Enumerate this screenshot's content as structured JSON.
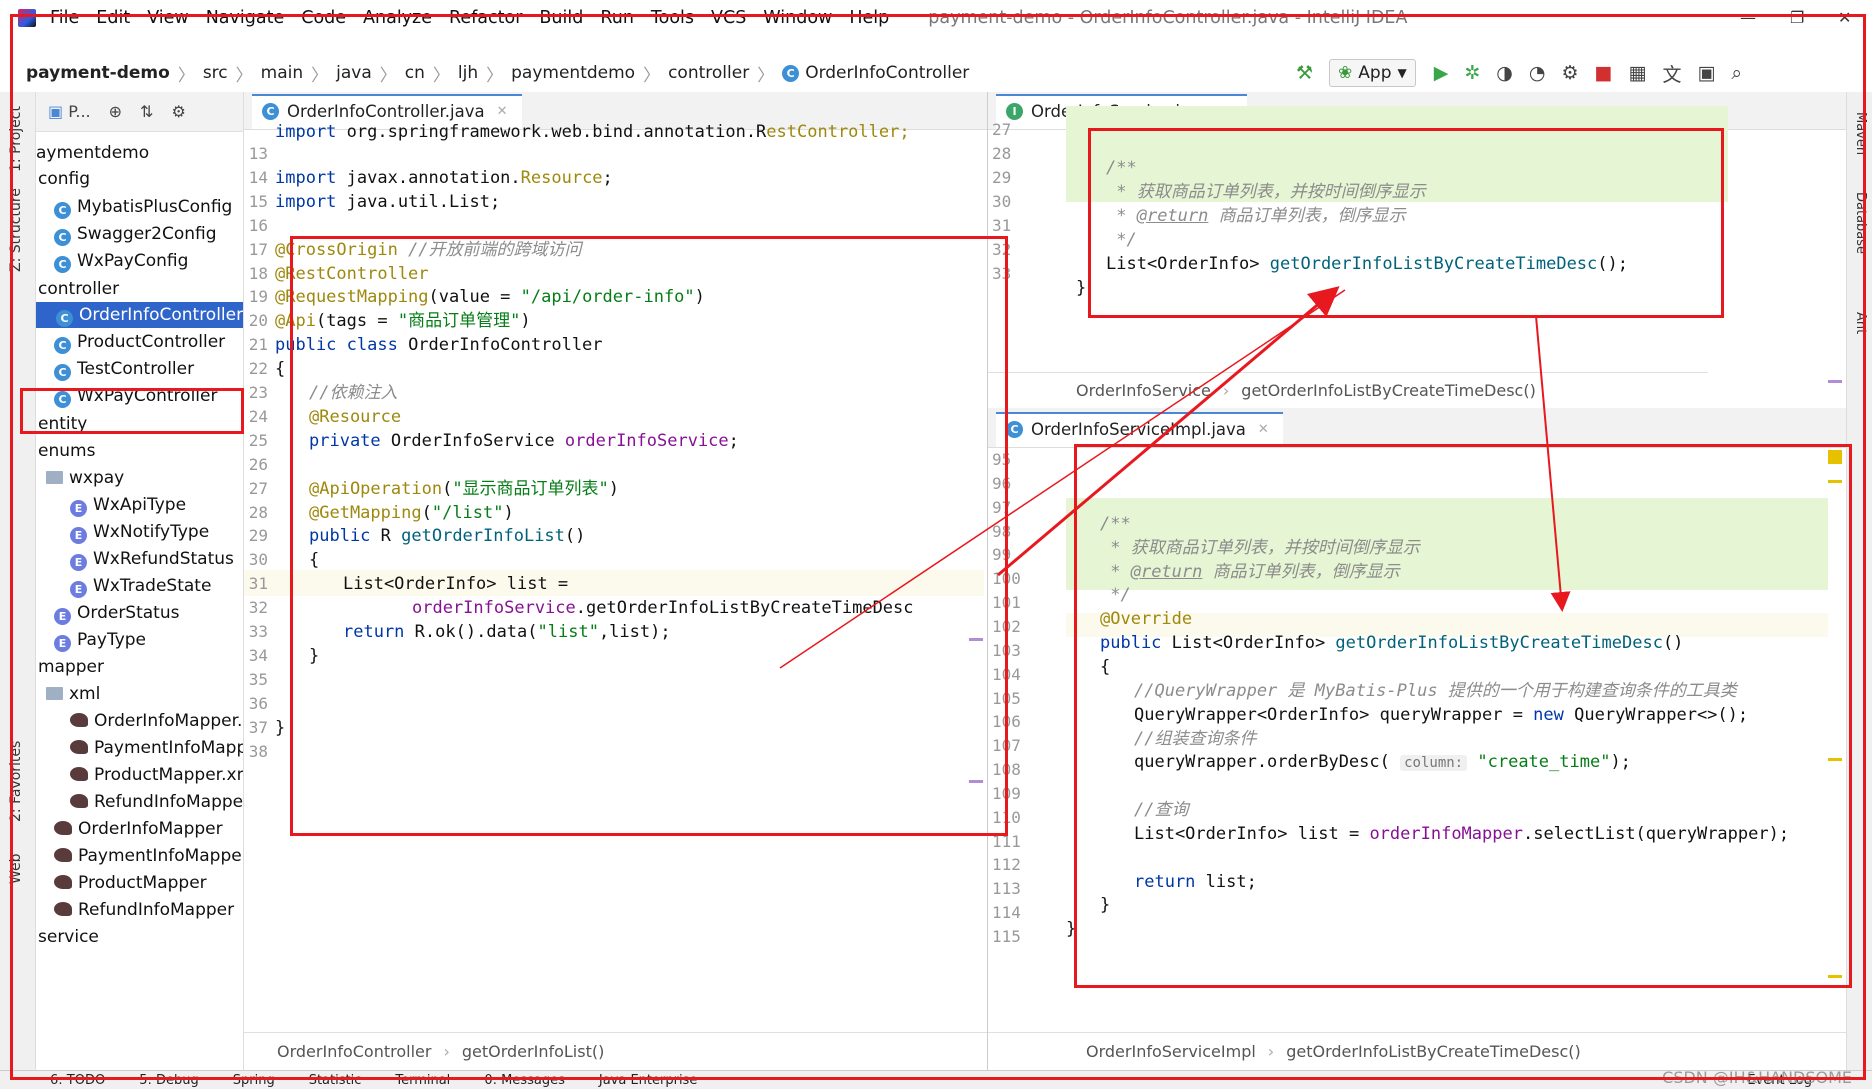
{
  "menu": {
    "items": [
      "File",
      "Edit",
      "View",
      "Navigate",
      "Code",
      "Analyze",
      "Refactor",
      "Build",
      "Run",
      "Tools",
      "VCS",
      "Window",
      "Help"
    ],
    "window_title": "payment-demo - OrderInfoController.java - IntelliJ IDEA"
  },
  "breadcrumb": {
    "project": "payment-demo",
    "parts": [
      "src",
      "main",
      "java",
      "cn",
      "ljh",
      "paymentdemo",
      "controller"
    ],
    "file": "OrderInfoController"
  },
  "toolbar": {
    "run_config": "App"
  },
  "left_strip": {
    "project_tab": "1: Project",
    "structure_tab": "Z: Structure",
    "favorites_tab": "2: Favorites",
    "web_tab": "Web"
  },
  "project_panel": {
    "header_label": "P...",
    "items": [
      {
        "label": "aymentdemo",
        "kind": "folder-open"
      },
      {
        "label": "config",
        "kind": "folder"
      },
      {
        "label": "MybatisPlusConfig",
        "kind": "class"
      },
      {
        "label": "Swagger2Config",
        "kind": "class"
      },
      {
        "label": "WxPayConfig",
        "kind": "class"
      },
      {
        "label": "controller",
        "kind": "folder"
      },
      {
        "label": "OrderInfoController",
        "kind": "class",
        "selected": true
      },
      {
        "label": "ProductController",
        "kind": "class"
      },
      {
        "label": "TestController",
        "kind": "class"
      },
      {
        "label": "WxPayController",
        "kind": "class"
      },
      {
        "label": "entity",
        "kind": "folder"
      },
      {
        "label": "enums",
        "kind": "folder"
      },
      {
        "label": "wxpay",
        "kind": "folder"
      },
      {
        "label": "WxApiType",
        "kind": "enum"
      },
      {
        "label": "WxNotifyType",
        "kind": "enum"
      },
      {
        "label": "WxRefundStatus",
        "kind": "enum"
      },
      {
        "label": "WxTradeState",
        "kind": "enum"
      },
      {
        "label": "OrderStatus",
        "kind": "enum"
      },
      {
        "label": "PayType",
        "kind": "enum"
      },
      {
        "label": "mapper",
        "kind": "folder"
      },
      {
        "label": "xml",
        "kind": "folder"
      },
      {
        "label": "OrderInfoMapper.",
        "kind": "mybatis"
      },
      {
        "label": "PaymentInfoMapp",
        "kind": "mybatis"
      },
      {
        "label": "ProductMapper.xn",
        "kind": "mybatis"
      },
      {
        "label": "RefundInfoMappe",
        "kind": "mybatis"
      },
      {
        "label": "OrderInfoMapper",
        "kind": "mybatis"
      },
      {
        "label": "PaymentInfoMapper",
        "kind": "mybatis"
      },
      {
        "label": "ProductMapper",
        "kind": "mybatis"
      },
      {
        "label": "RefundInfoMapper",
        "kind": "mybatis"
      },
      {
        "label": "service",
        "kind": "folder"
      }
    ]
  },
  "editor_controller": {
    "tab": "OrderInfoController.java",
    "status_class": "OrderInfoController",
    "status_method": "getOrderInfoList()",
    "line_numbers": [
      "13",
      "14",
      "15",
      "16",
      "17",
      "18",
      "19",
      "20",
      "21",
      "22",
      "23",
      "24",
      "25",
      "26",
      "27",
      "28",
      "29",
      "30",
      "31",
      "32",
      "33",
      "34",
      "35",
      "36",
      "37",
      "38"
    ],
    "top_cut": "import org.springframework.web.bind.annotation.RestController;",
    "l14_kw": "import",
    "l14_rest": " javax.annotation.",
    "l14_cls": "Resource",
    "l14_end": ";",
    "l15_kw": "import",
    "l15_rest": " java.util.List;",
    "l17_ann": "@CrossOrigin",
    "l17_cm": " //开放前端的跨域访问",
    "l18_ann": "@RestController",
    "l19_ann": "@RequestMapping",
    "l19_a": "(value = ",
    "l19_str": "\"/api/order-info\"",
    "l19_b": ")",
    "l20_ann": "@Api",
    "l20_a": "(tags = ",
    "l20_str": "\"商品订单管理\"",
    "l20_b": ")",
    "l21_kw": "public class",
    "l21_rest": " OrderInfoController",
    "l22": "{",
    "l23_cm": "//依赖注入",
    "l24_ann": "@Resource",
    "l25_kw": "private",
    "l25_a": " OrderInfoService ",
    "l25_fld": "orderInfoService",
    "l25_b": ";",
    "l27_ann": "@ApiOperation",
    "l27_a": "(",
    "l27_str": "\"显示商品订单列表\"",
    "l27_b": ")",
    "l28_ann": "@GetMapping",
    "l28_a": "(",
    "l28_str": "\"/list\"",
    "l28_b": ")",
    "l29_kw": "public",
    "l29_a": " R ",
    "l29_mth": "getOrderInfoList",
    "l29_b": "()",
    "l30": "{",
    "l31": "List<OrderInfo> list =",
    "l32_fld": "orderInfoService",
    "l32_rest": ".getOrderInfoListByCreateTimeDesc",
    "l33_kw": "return",
    "l33_a": " R.",
    "l33_it": "ok",
    "l33_b": "().data(",
    "l33_str": "\"list\"",
    "l33_c": ",list);",
    "l34": "}",
    "l37": "}"
  },
  "editor_service": {
    "tab": "OrderInfoService.java",
    "status_class": "OrderInfoService",
    "status_method": "getOrderInfoListByCreateTimeDesc()",
    "line_numbers": [
      "27",
      "28",
      "29",
      "30",
      "31",
      "32",
      "33"
    ],
    "doc1": "/**",
    "doc2": " * 获取商品订单列表，并按时间倒序显示",
    "doc3_a": " * ",
    "doc3_tag": "@return",
    "doc3_b": " 商品订单列表，倒序显示",
    "doc4": " */",
    "sig_a": "List<OrderInfo> ",
    "sig_mth": "getOrderInfoListByCreateTimeDesc",
    "sig_b": "();",
    "close": "}"
  },
  "editor_impl": {
    "tab": "OrderInfoServiceImpl.java",
    "status_class": "OrderInfoServiceImpl",
    "status_method": "getOrderInfoListByCreateTimeDesc()",
    "line_numbers": [
      "95",
      "96",
      "97",
      "98",
      "99",
      "100",
      "101",
      "102",
      "103",
      "104",
      "105",
      "106",
      "107",
      "108",
      "109",
      "110",
      "111",
      "112",
      "113",
      "114",
      "115"
    ],
    "doc1": "/**",
    "doc2": " * 获取商品订单列表，并按时间倒序显示",
    "doc3_a": " * ",
    "doc3_tag": "@return",
    "doc3_b": " 商品订单列表，倒序显示",
    "doc4": " */",
    "override": "@Override",
    "sig_kw": "public",
    "sig_a": " List<OrderInfo> ",
    "sig_mth": "getOrderInfoListByCreateTimeDesc",
    "sig_b": "()",
    "open": "{",
    "cm1": "//QueryWrapper 是 MyBatis-Plus 提供的一个用于构建查询条件的工具类",
    "qw_a": "QueryWrapper<OrderInfo> queryWrapper = ",
    "qw_kw": "new",
    "qw_b": " QueryWrapper<>();",
    "cm2": "//组装查询条件",
    "order_a": "queryWrapper.orderByDesc( ",
    "order_hint": "column:",
    "order_str": "\"create_time\"",
    "order_b": ");",
    "cm3": "//查询",
    "sel_a": "List<OrderInfo> ",
    "sel_var": "list",
    "sel_b": " = ",
    "sel_fld": "orderInfoMapper",
    "sel_c": ".selectList(queryWrapper);",
    "ret_kw": "return",
    "ret_b": " list;",
    "close1": "}",
    "close2": "}"
  },
  "bottom_tabs": [
    "6: TODO",
    "5: Debug",
    "Spring",
    "Statistic",
    "Terminal",
    "0: Messages",
    "Java Enterprise",
    "Event Log"
  ],
  "right_strip": [
    "Maven",
    "Database",
    "Ant"
  ],
  "watermark": "CSDN @IH&HANDSOME",
  "colors": {
    "selection": "#2f65ca",
    "annotation_box": "#e8191e",
    "doc_bg": "#e6f5d3"
  }
}
